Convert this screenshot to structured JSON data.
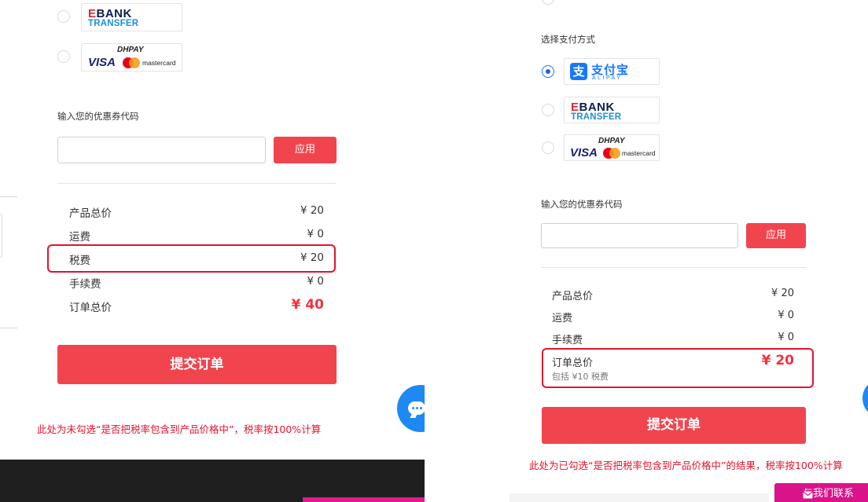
{
  "left": {
    "payment_methods": [
      {
        "name": "EBANK TRANSFER",
        "ebank_e": "E",
        "ebank_bank": "BANK",
        "ebank_transfer": "TRANSFER",
        "selected": false
      },
      {
        "name": "DHPAY VISA mastercard",
        "dhpay": "DHPAY",
        "visa": "VISA",
        "mastercard": "mastercard",
        "selected": false
      }
    ],
    "coupon_label": "输入您的优惠券代码",
    "coupon_value": "",
    "apply_label": "应用",
    "summary": {
      "rows": [
        {
          "label": "产品总价",
          "value": "¥ 20"
        },
        {
          "label": "运费",
          "value": "¥ 0"
        },
        {
          "label": "税费",
          "value": "¥ 20"
        },
        {
          "label": "手续费",
          "value": "¥ 0"
        },
        {
          "label": "订单总价",
          "value": "¥ 40"
        }
      ]
    },
    "submit_label": "提交订单",
    "note": "此处为未勾选“是否把税率包含到产品价格中”，税率按100%计算"
  },
  "right": {
    "section_title": "选择支付方式",
    "payment_methods": [
      {
        "name": "支付宝 ALIPAY",
        "alipay_icon": "支",
        "alipay_cn": "支付宝",
        "alipay_en": "ALIPAY",
        "selected": true
      },
      {
        "name": "EBANK TRANSFER",
        "ebank_e": "E",
        "ebank_bank": "BANK",
        "ebank_transfer": "TRANSFER",
        "selected": false
      },
      {
        "name": "DHPAY VISA mastercard",
        "dhpay": "DHPAY",
        "visa": "VISA",
        "mastercard": "mastercard",
        "selected": false
      }
    ],
    "coupon_label": "输入您的优惠券代码",
    "coupon_value": "",
    "apply_label": "应用",
    "summary": {
      "rows": [
        {
          "label": "产品总价",
          "value": "¥ 20"
        },
        {
          "label": "运费",
          "value": "¥ 0"
        },
        {
          "label": "手续费",
          "value": "¥ 0"
        },
        {
          "label": "订单总价",
          "value": "¥ 20",
          "sub": "包括 ¥10 税费"
        }
      ]
    },
    "submit_label": "提交订单",
    "note": "此处为已勾选“是否把税率包含到产品价格中”的结果，税率按100%计算",
    "contact_label": "与我们联系"
  },
  "colors": {
    "accent": "#f0454f",
    "highlight": "#e3132d",
    "total": "#ef3340",
    "chat": "#1e88f5",
    "contact": "#d9138a"
  },
  "icons": [
    "chat-icon",
    "envelope-icon",
    "alipay-icon",
    "mastercard-icon"
  ]
}
